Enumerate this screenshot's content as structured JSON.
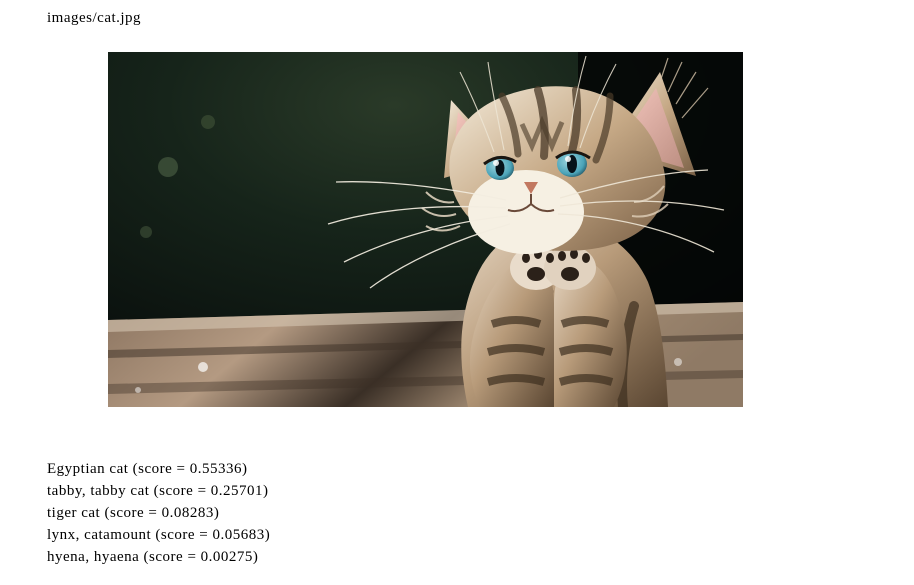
{
  "path_label": "images/cat.jpg",
  "results": [
    {
      "label": "Egyptian cat",
      "score": "0.55336"
    },
    {
      "label": "tabby, tabby cat",
      "score": "0.25701"
    },
    {
      "label": "tiger cat",
      "score": "0.08283"
    },
    {
      "label": "lynx, catamount",
      "score": "0.05683"
    },
    {
      "label": "hyena, hyaena",
      "score": "0.00275"
    }
  ],
  "score_prefix": " (score = ",
  "score_suffix": ")"
}
